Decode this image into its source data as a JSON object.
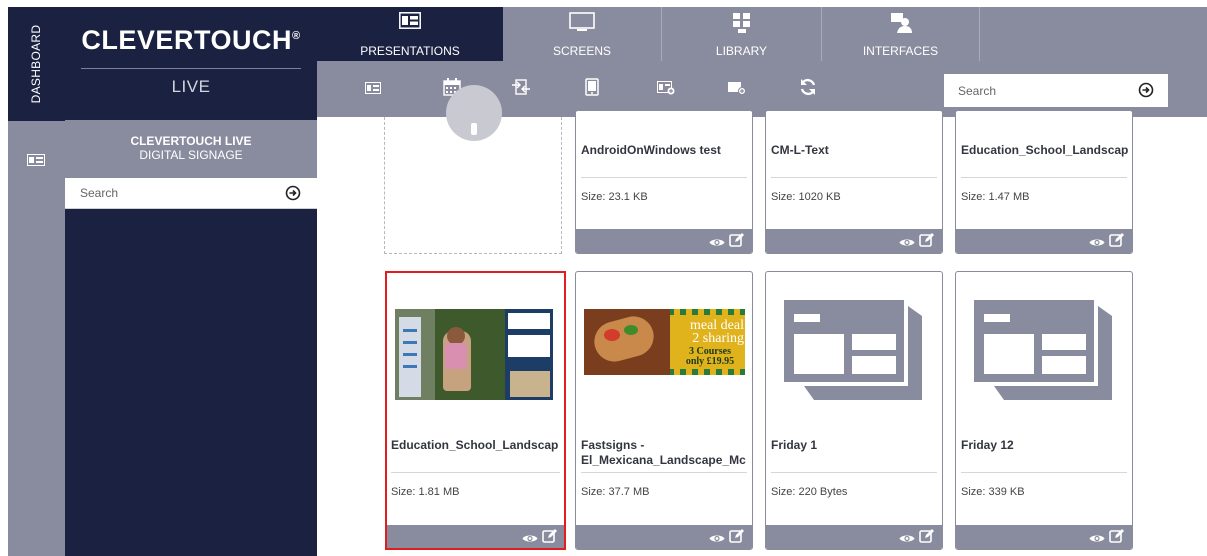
{
  "sidebar_strip": {
    "label": "DASHBOARD"
  },
  "brand": {
    "name": "CLEVERTOUCH",
    "mark": "®",
    "subtitle": "LIVE"
  },
  "side_panel": {
    "title_line1": "CLEVERTOUCH LIVE",
    "title_line2": "DIGITAL SIGNAGE",
    "search_placeholder": "Search"
  },
  "tabs": [
    {
      "label": "PRESENTATIONS",
      "icon": "presentation-icon",
      "active": true
    },
    {
      "label": "SCREENS",
      "icon": "monitor-icon",
      "active": false
    },
    {
      "label": "LIBRARY",
      "icon": "library-icon",
      "active": false
    },
    {
      "label": "INTERFACES",
      "icon": "interface-icon",
      "active": false
    }
  ],
  "toolbar": {
    "icons": [
      "presentation-icon",
      "calendar-icon",
      "transfer-icon",
      "tablet-icon",
      "add-layout-icon",
      "add-screen-icon",
      "refresh-icon"
    ],
    "search_placeholder": "Search"
  },
  "cards": [
    {
      "name": "AndroidOnWindows test",
      "size": "Size: 23.1 KB"
    },
    {
      "name": "CM-L-Text",
      "size": "Size: 1020 KB"
    },
    {
      "name": "Education_School_Landscap",
      "size": "Size: 1.47 MB"
    },
    {
      "name": "Education_School_Landscap",
      "size": "Size: 1.81 MB",
      "selected": true
    },
    {
      "name_line1": "Fastsigns -",
      "name_line2": "El_Mexicana_Landscape_Mc",
      "size": "Size: 37.7 MB"
    },
    {
      "name": "Friday 1",
      "size": "Size: 220 Bytes"
    },
    {
      "name": "Friday 12",
      "size": "Size: 339 KB"
    }
  ],
  "thumb_text": {
    "meal_deal": "meal deal",
    "sharing": "2 sharing",
    "courses": "3 Courses",
    "price": "only £19.95"
  },
  "colors": {
    "navy": "#1b2141",
    "gray": "#898c9e",
    "selection": "#e01e1e"
  }
}
